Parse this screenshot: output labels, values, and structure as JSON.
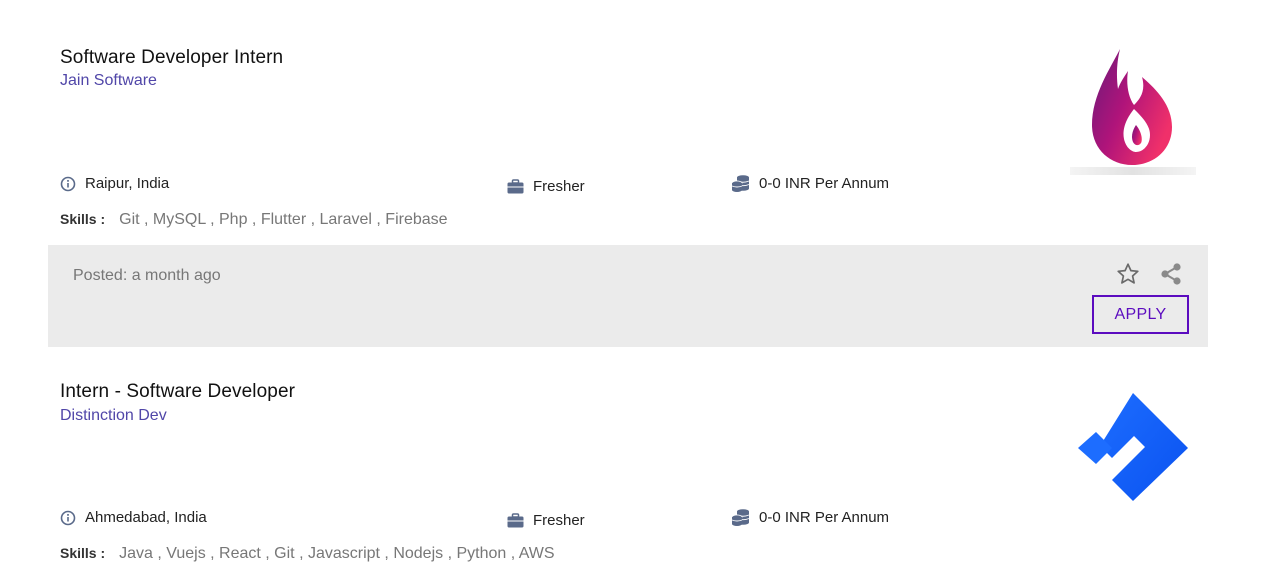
{
  "jobs": [
    {
      "title": "Software Developer Intern",
      "company": "Jain Software",
      "location": "Raipur, India",
      "experience": "Fresher",
      "salary": "0-0 INR Per Annum",
      "skills_label": "Skills :",
      "skills": "Git , MySQL , Php , Flutter , Laravel , Firebase",
      "logo_icon": "flame-logo-icon"
    },
    {
      "title": "Intern - Software Developer",
      "company": "Distinction Dev",
      "location": "Ahmedabad, India",
      "experience": "Fresher",
      "salary": "0-0 INR Per Annum",
      "skills_label": "Skills :",
      "skills": "Java , Vuejs , React , Git , Javascript , Nodejs , Python , AWS",
      "logo_icon": "diamond-logo-icon"
    }
  ],
  "footer": {
    "posted": "Posted: a month ago",
    "apply_label": "APPLY",
    "star_icon": "star-icon",
    "share_icon": "share-icon"
  },
  "colors": {
    "company": "#5046a8",
    "apply": "#5b0bbf",
    "footer_bg": "#ebebeb",
    "meta_icon": "#5a6a8a"
  }
}
